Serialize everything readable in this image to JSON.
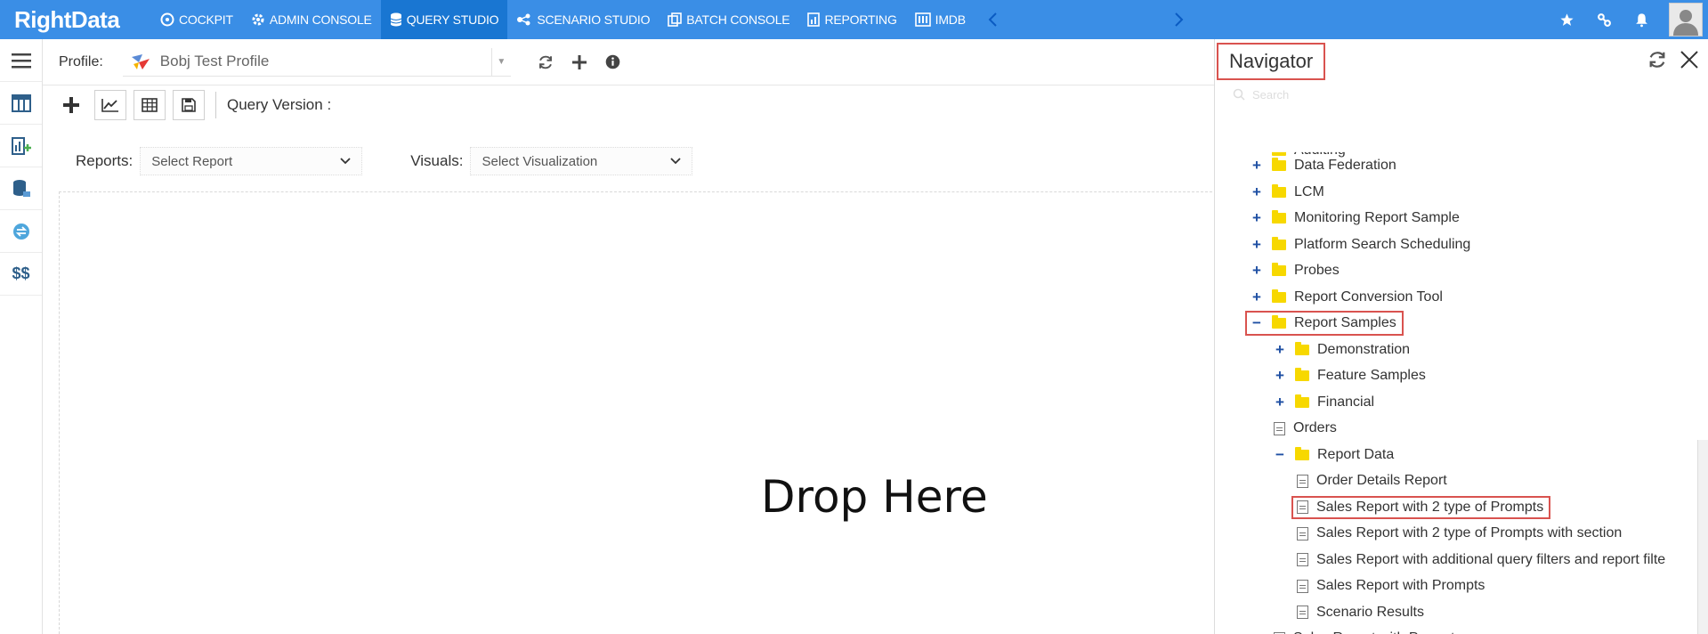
{
  "app": {
    "logo_text": "RightData",
    "nav": [
      {
        "label": "COCKPIT",
        "icon": "cockpit-icon"
      },
      {
        "label": "ADMIN CONSOLE",
        "icon": "gear-icon"
      },
      {
        "label": "QUERY STUDIO",
        "icon": "database-icon",
        "active": true
      },
      {
        "label": "SCENARIO STUDIO",
        "icon": "scenario-icon"
      },
      {
        "label": "BATCH CONSOLE",
        "icon": "batch-icon"
      },
      {
        "label": "REPORTING",
        "icon": "report-icon"
      },
      {
        "label": "IMDB",
        "icon": "imdb-icon"
      }
    ],
    "top_icons": [
      "star-icon",
      "link-icon",
      "bell-icon",
      "user-avatar"
    ],
    "accent_color": "#3a8ee6"
  },
  "leftrail": {
    "items": [
      "menu-icon",
      "table-icon",
      "chart-add-icon",
      "database-stack-icon",
      "compare-icon",
      "dollar-icon"
    ],
    "dollar_label": "$$"
  },
  "profile": {
    "label": "Profile:",
    "value": "Bobj Test Profile",
    "actions": [
      "refresh-icon",
      "plus-icon",
      "info-icon"
    ]
  },
  "toolbar": {
    "query_version_label": "Query Version :"
  },
  "selectors": {
    "reports_label": "Reports:",
    "reports_value": "Select Report",
    "visuals_label": "Visuals:",
    "visuals_value": "Select Visualization"
  },
  "canvas": {
    "drop_text": "Drop Here"
  },
  "navigator": {
    "title": "Navigator",
    "search_placeholder": "Search",
    "tree": [
      {
        "label": "Auditing",
        "type": "folder",
        "toggle": "",
        "level": 0,
        "partial": true
      },
      {
        "label": "Data Federation",
        "type": "folder",
        "toggle": "+",
        "level": 0
      },
      {
        "label": "LCM",
        "type": "folder",
        "toggle": "+",
        "level": 0
      },
      {
        "label": "Monitoring Report Sample",
        "type": "folder",
        "toggle": "+",
        "level": 0
      },
      {
        "label": "Platform Search Scheduling",
        "type": "folder",
        "toggle": "+",
        "level": 0
      },
      {
        "label": "Probes",
        "type": "folder",
        "toggle": "+",
        "level": 0
      },
      {
        "label": "Report Conversion Tool",
        "type": "folder",
        "toggle": "+",
        "level": 0
      },
      {
        "label": "Report Samples",
        "type": "folder",
        "toggle": "−",
        "level": 0,
        "highlight": true
      },
      {
        "label": "Demonstration",
        "type": "folder",
        "toggle": "+",
        "level": 1
      },
      {
        "label": "Feature Samples",
        "type": "folder",
        "toggle": "+",
        "level": 1
      },
      {
        "label": "Financial",
        "type": "folder",
        "toggle": "+",
        "level": 1
      },
      {
        "label": "Orders",
        "type": "doc",
        "toggle": "",
        "level": 1
      },
      {
        "label": "Report Data",
        "type": "folder",
        "toggle": "−",
        "level": 1
      },
      {
        "label": "Order Details Report",
        "type": "doc",
        "toggle": "",
        "level": 2
      },
      {
        "label": "Sales Report with 2 type of Prompts",
        "type": "doc",
        "toggle": "",
        "level": 2,
        "highlight": true
      },
      {
        "label": "Sales Report with 2 type of Prompts with section",
        "type": "doc",
        "toggle": "",
        "level": 2
      },
      {
        "label": "Sales Report with additional query filters and report filte",
        "type": "doc",
        "toggle": "",
        "level": 2
      },
      {
        "label": "Sales Report with Prompts",
        "type": "doc",
        "toggle": "",
        "level": 2
      },
      {
        "label": "Scenario Results",
        "type": "doc",
        "toggle": "",
        "level": 2
      },
      {
        "label": "Sales Report with Prompts",
        "type": "doc",
        "toggle": "",
        "level": 1
      }
    ]
  }
}
